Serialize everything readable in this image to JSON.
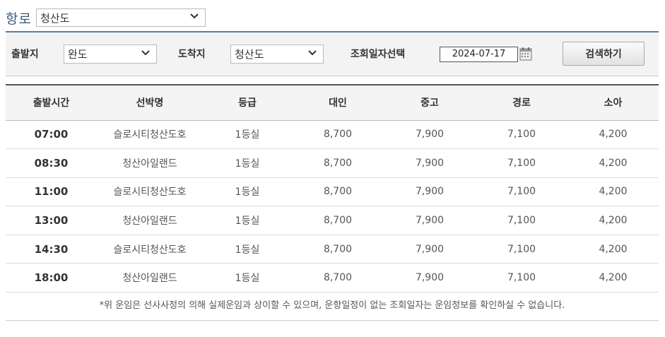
{
  "route": {
    "label": "항로",
    "selected": "청산도"
  },
  "search": {
    "departure_label": "출발지",
    "departure_value": "완도",
    "arrival_label": "도착지",
    "arrival_value": "청산도",
    "date_label": "조회일자선택",
    "date_value": "2024-07-17",
    "search_button": "검색하기"
  },
  "table": {
    "headers": [
      "출발시간",
      "선박명",
      "등급",
      "대인",
      "중고",
      "경로",
      "소아"
    ],
    "rows": [
      [
        "07:00",
        "슬로시티청산도호",
        "1등실",
        "8,700",
        "7,900",
        "7,100",
        "4,200"
      ],
      [
        "08:30",
        "청산아일랜드",
        "1등실",
        "8,700",
        "7,900",
        "7,100",
        "4,200"
      ],
      [
        "11:00",
        "슬로시티청산도호",
        "1등실",
        "8,700",
        "7,900",
        "7,100",
        "4,200"
      ],
      [
        "13:00",
        "청산아일랜드",
        "1등실",
        "8,700",
        "7,900",
        "7,100",
        "4,200"
      ],
      [
        "14:30",
        "슬로시티청산도호",
        "1등실",
        "8,700",
        "7,900",
        "7,100",
        "4,200"
      ],
      [
        "18:00",
        "청산아일랜드",
        "1등실",
        "8,700",
        "7,900",
        "7,100",
        "4,200"
      ]
    ]
  },
  "note": "*위 운임은 선사사정의 의해 실제운임과 상이할 수 있으며, 운항일정이 없는 조회일자는 운임정보를 확인하실 수 없습니다.",
  "icons": {
    "dropdown": "chevron-down-icon",
    "calendar": "calendar-icon"
  }
}
